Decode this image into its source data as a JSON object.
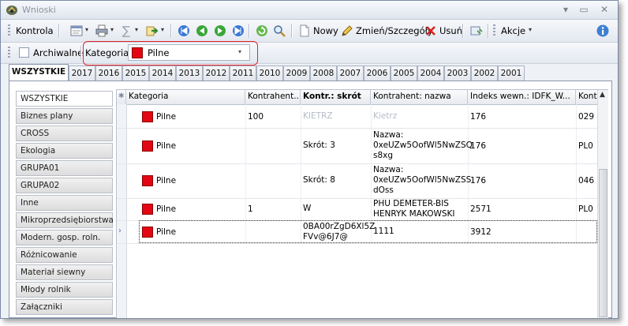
{
  "window": {
    "title": "Wnioski"
  },
  "toolbar": {
    "kontrola": "Kontrola",
    "nowy": "Nowy",
    "zmien": "Zmień/Szczegóły",
    "usun": "Usuń",
    "akcje": "Akcje"
  },
  "filter": {
    "archiwalne": "Archiwalne",
    "kategoria_label": "Kategoria",
    "kategoria_value": "Pilne",
    "kategoria_color": "#e30613"
  },
  "tabs": [
    "WSZYSTKIE",
    "2017",
    "2016",
    "2015",
    "2014",
    "2013",
    "2012",
    "2011",
    "2010",
    "2009",
    "2008",
    "2007",
    "2006",
    "2005",
    "2004",
    "2003",
    "2002",
    "2001"
  ],
  "sidebar": [
    "WSZYSTKIE",
    "Biznes plany",
    "CROSS",
    "Ekologia",
    "GRUPA01",
    "GRUPA02",
    "Inne",
    "Mikroprzedsiębiorstwa",
    "Modern. gosp. roln.",
    "Różnicowanie",
    "Materiał siewny",
    "Młody rolnik",
    "Załączniki"
  ],
  "columns": [
    "Kategoria",
    "Kontrahent...",
    "Kontr.: skrót",
    "Kontrahent: nazwa",
    "Indeks wewn.: IDFK_W...",
    "Kont"
  ],
  "rows": [
    {
      "kategoria": "Pilne",
      "kontrahent": "100",
      "skrot": "KIETRZ",
      "nazwa": [
        "Kietrz"
      ],
      "indeks": "176",
      "kont": "029"
    },
    {
      "kategoria": "Pilne",
      "kontrahent": "",
      "skrot": "Skrót: 3",
      "nazwa": [
        "Nazwa:",
        "0xeUZw5OofWl5NwZSQ",
        "s8xg"
      ],
      "indeks": "176",
      "kont": "PL0"
    },
    {
      "kategoria": "Pilne",
      "kontrahent": "",
      "skrot": "Skrót: 8",
      "nazwa": [
        "Nazwa:",
        "0xeUZw5OofWl5NwZSS",
        "dOss"
      ],
      "indeks": "176",
      "kont": "046"
    },
    {
      "kategoria": "Pilne",
      "kontrahent": "1",
      "skrot": "W",
      "nazwa": [
        "PHU DEMETER-BIS",
        "HENRYK MAKOWSKI"
      ],
      "indeks": "2571",
      "kont": "PL0"
    },
    {
      "kategoria": "Pilne",
      "kontrahent": "",
      "skrot": "0BA00rZgD6Xl5Z\nFVv@6J7@",
      "nazwa": [
        "1111"
      ],
      "indeks": "3912",
      "kont": ""
    }
  ],
  "colors": {
    "accent_red": "#e30613",
    "highlight_frame": "#e3262a"
  }
}
